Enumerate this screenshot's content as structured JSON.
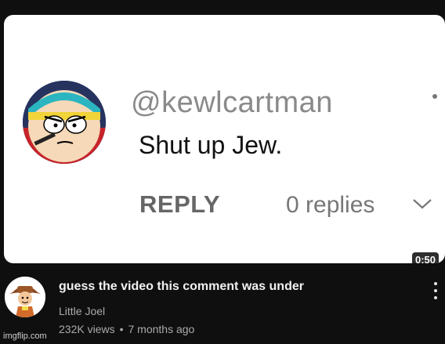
{
  "comment_card": {
    "username": "@kewlcartman",
    "text": "Shut up Jew.",
    "reply_label": "REPLY",
    "replies_label": "0 replies",
    "avatar_icon": "cartman-avatar-icon",
    "chevron_icon": "chevron-down-icon",
    "more_icon": "dot-icon"
  },
  "video": {
    "duration": "0:50",
    "title": "guess the video this comment was under",
    "channel": "Little Joel",
    "views": "232K views",
    "age": "7 months ago",
    "channel_avatar_icon": "cowboy-avatar-icon",
    "more_icon": "vertical-ellipsis-icon"
  },
  "watermark": "imgflip.com",
  "colors": {
    "page_bg": "#0f0f0f",
    "card_bg": "#ffffff",
    "username": "#8a8a8a",
    "meta_text": "#aaaaaa"
  }
}
